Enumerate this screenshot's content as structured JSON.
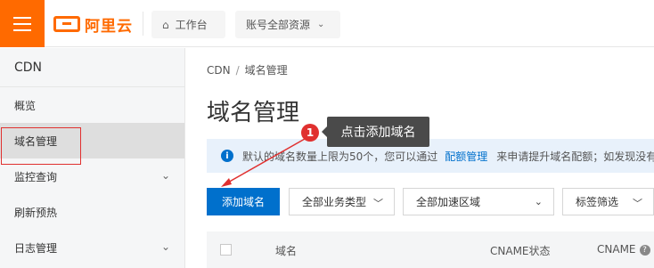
{
  "topbar": {
    "brand": "阿里云",
    "workbench_label": "工作台",
    "account_label": "账号全部资源"
  },
  "sidebar": {
    "title": "CDN",
    "items": [
      {
        "label": "概览"
      },
      {
        "label": "域名管理"
      },
      {
        "label": "监控查询"
      },
      {
        "label": "刷新预热"
      },
      {
        "label": "日志管理"
      }
    ]
  },
  "breadcrumb": {
    "root": "CDN",
    "separator": "/",
    "current": "域名管理"
  },
  "page_title": "域名管理",
  "notice": {
    "text_before": "默认的域名数量上限为50个，您可以通过",
    "link": "配额管理",
    "text_after": "来申请提升域名配额；如发现没有"
  },
  "toolbar": {
    "add_button": "添加域名",
    "business_type": "全部业务类型",
    "region": "全部加速区域",
    "tag_filter": "标签筛选"
  },
  "table": {
    "columns": [
      "域名",
      "CNAME状态",
      "CNAME"
    ]
  },
  "annotation": {
    "step": "1",
    "tooltip": "点击添加域名"
  },
  "colors": {
    "brand": "#ff6a00",
    "primary": "#0070cc",
    "annotation": "#e0302f"
  }
}
